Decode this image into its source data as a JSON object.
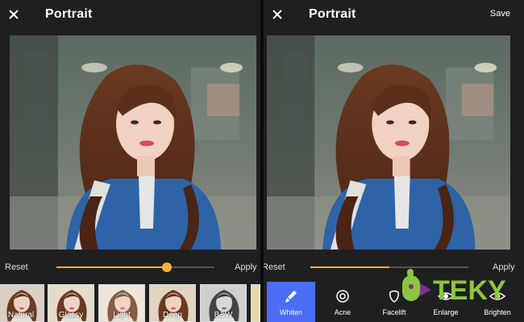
{
  "left_panel": {
    "title": "Portrait",
    "reset_label": "Reset",
    "apply_label": "Apply",
    "slider_value": 0.7,
    "filters": [
      {
        "label": "Natural",
        "icon": "natural-filter-thumbnail"
      },
      {
        "label": "Glossy",
        "icon": "glossy-filter-thumbnail"
      },
      {
        "label": "Light",
        "icon": "light-filter-thumbnail"
      },
      {
        "label": "Deep",
        "icon": "deep-filter-thumbnail"
      },
      {
        "label": "B&W",
        "icon": "bw-filter-thumbnail"
      }
    ]
  },
  "right_panel": {
    "title": "Portrait",
    "save_label": "Save",
    "reset_label": "Reset",
    "apply_label": "Apply",
    "slider_value": 0.5,
    "tools": [
      {
        "label": "Whiten",
        "icon": "brush-icon",
        "active": true
      },
      {
        "label": "Acne",
        "icon": "target-icon",
        "active": false
      },
      {
        "label": "Facelift",
        "icon": "face-icon",
        "active": false
      },
      {
        "label": "Enlarge",
        "icon": "eye-icon",
        "active": false
      },
      {
        "label": "Brighten",
        "icon": "eye-bright-icon",
        "active": false
      }
    ]
  },
  "watermark": {
    "text": "TEKY"
  },
  "colors": {
    "accent": "#f0b23a",
    "active_tool": "#4a6cf7",
    "panel_bg": "#1f1f1f",
    "brand_green": "#8cc63e",
    "brand_purple": "#7b2f8f"
  }
}
